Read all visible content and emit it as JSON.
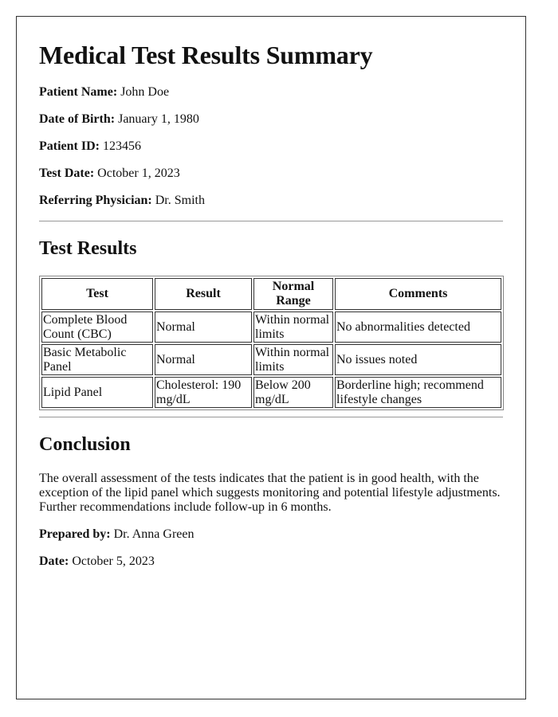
{
  "title": "Medical Test Results Summary",
  "patient_info": [
    {
      "label": "Patient Name:",
      "value": "John Doe"
    },
    {
      "label": "Date of Birth:",
      "value": "January 1, 1980"
    },
    {
      "label": "Patient ID:",
      "value": "123456"
    },
    {
      "label": "Test Date:",
      "value": "October 1, 2023"
    },
    {
      "label": "Referring Physician:",
      "value": "Dr. Smith"
    }
  ],
  "results_heading": "Test Results",
  "table": {
    "headers": [
      "Test",
      "Result",
      "Normal Range",
      "Comments"
    ],
    "rows": [
      [
        "Complete Blood Count (CBC)",
        "Normal",
        "Within normal limits",
        "No abnormalities detected"
      ],
      [
        "Basic Metabolic Panel",
        "Normal",
        "Within normal limits",
        "No issues noted"
      ],
      [
        "Lipid Panel",
        "Cholesterol: 190 mg/dL",
        "Below 200 mg/dL",
        "Borderline high; recommend lifestyle changes"
      ]
    ]
  },
  "conclusion_heading": "Conclusion",
  "conclusion_text": "The overall assessment of the tests indicates that the patient is in good health, with the exception of the lipid panel which suggests monitoring and potential lifestyle adjustments. Further recommendations include follow-up in 6 months.",
  "footer": [
    {
      "label": "Prepared by:",
      "value": "Dr. Anna Green"
    },
    {
      "label": "Date:",
      "value": "October 5, 2023"
    }
  ]
}
